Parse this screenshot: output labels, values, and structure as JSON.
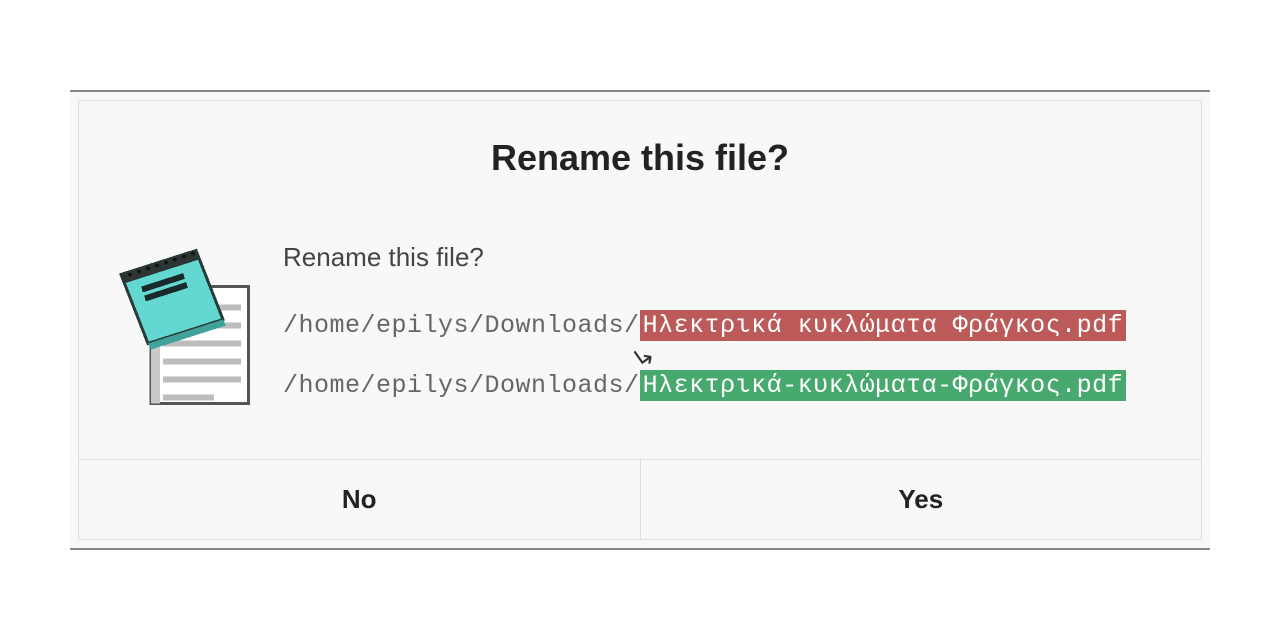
{
  "dialog": {
    "title": "Rename this file?",
    "subtitle": "Rename this file?",
    "old_path_prefix": "/home/epilys/Downloads/",
    "old_path_name": "Ηλεκτρικά κυκλώματα Φράγκος.pdf",
    "new_path_prefix": "/home/epilys/Downloads/",
    "new_path_name": "Ηλεκτρικά-κυκλώματα-Φράγκος.pdf",
    "no_label": "No",
    "yes_label": "Yes"
  }
}
